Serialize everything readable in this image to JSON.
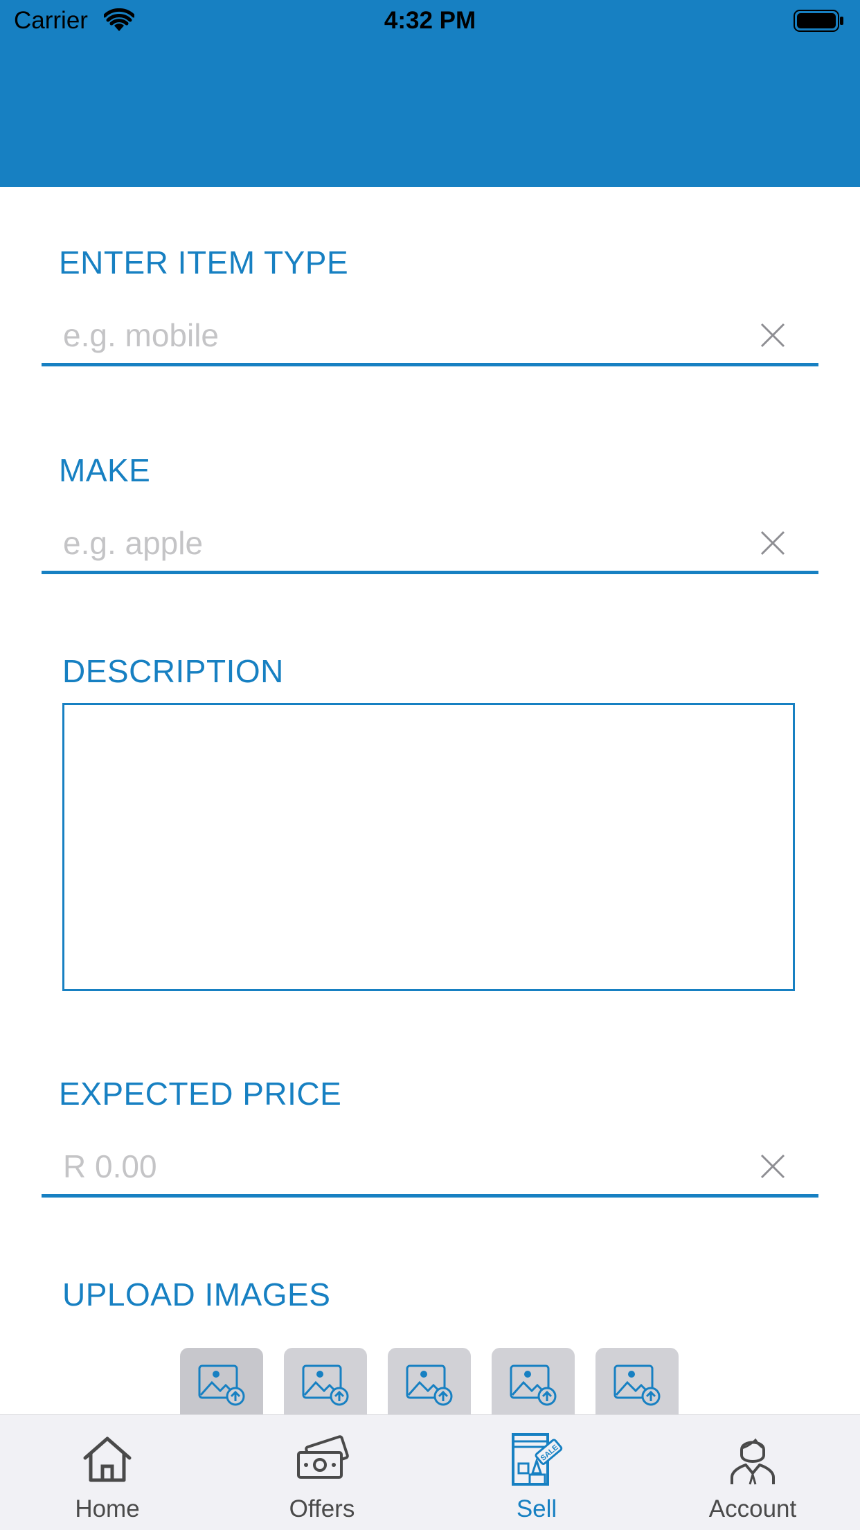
{
  "status_bar": {
    "carrier": "Carrier",
    "time": "4:32 PM"
  },
  "form": {
    "item_type": {
      "label": "ENTER ITEM TYPE",
      "placeholder": "e.g. mobile"
    },
    "make": {
      "label": "MAKE",
      "placeholder": "e.g. apple"
    },
    "description": {
      "label": "DESCRIPTION",
      "value": ""
    },
    "price": {
      "label": "EXPECTED PRICE",
      "placeholder": "R 0.00"
    },
    "upload": {
      "label": "UPLOAD IMAGES",
      "slots": 5
    }
  },
  "tabs": [
    {
      "label": "Home",
      "icon": "home-icon"
    },
    {
      "label": "Offers",
      "icon": "offers-icon"
    },
    {
      "label": "Sell",
      "icon": "sell-icon",
      "active": true
    },
    {
      "label": "Account",
      "icon": "account-icon"
    }
  ],
  "colors": {
    "accent": "#1780c2",
    "placeholder": "#c4c4c6",
    "tabbar": "#f1f1f5"
  }
}
